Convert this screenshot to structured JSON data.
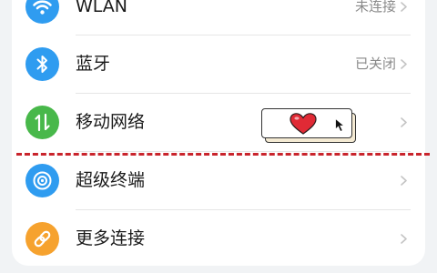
{
  "settings": {
    "rows": [
      {
        "label": "WLAN",
        "value": "未连接",
        "icon": "wifi-icon",
        "color": "#2f9cf0"
      },
      {
        "label": "蓝牙",
        "value": "已关闭",
        "icon": "bluetooth-icon",
        "color": "#2f9cf0"
      },
      {
        "label": "移动网络",
        "value": "",
        "icon": "mobile-data-icon",
        "color": "#48b84a"
      },
      {
        "label": "超级终端",
        "value": "",
        "icon": "super-device-icon",
        "color": "#2f9cf0"
      },
      {
        "label": "更多连接",
        "value": "",
        "icon": "link-icon",
        "color": "#f6a22e"
      }
    ]
  },
  "overlay": {
    "sticker_icons": [
      "heart-icon",
      "cursor-icon"
    ],
    "line_color": "#c9242c"
  }
}
